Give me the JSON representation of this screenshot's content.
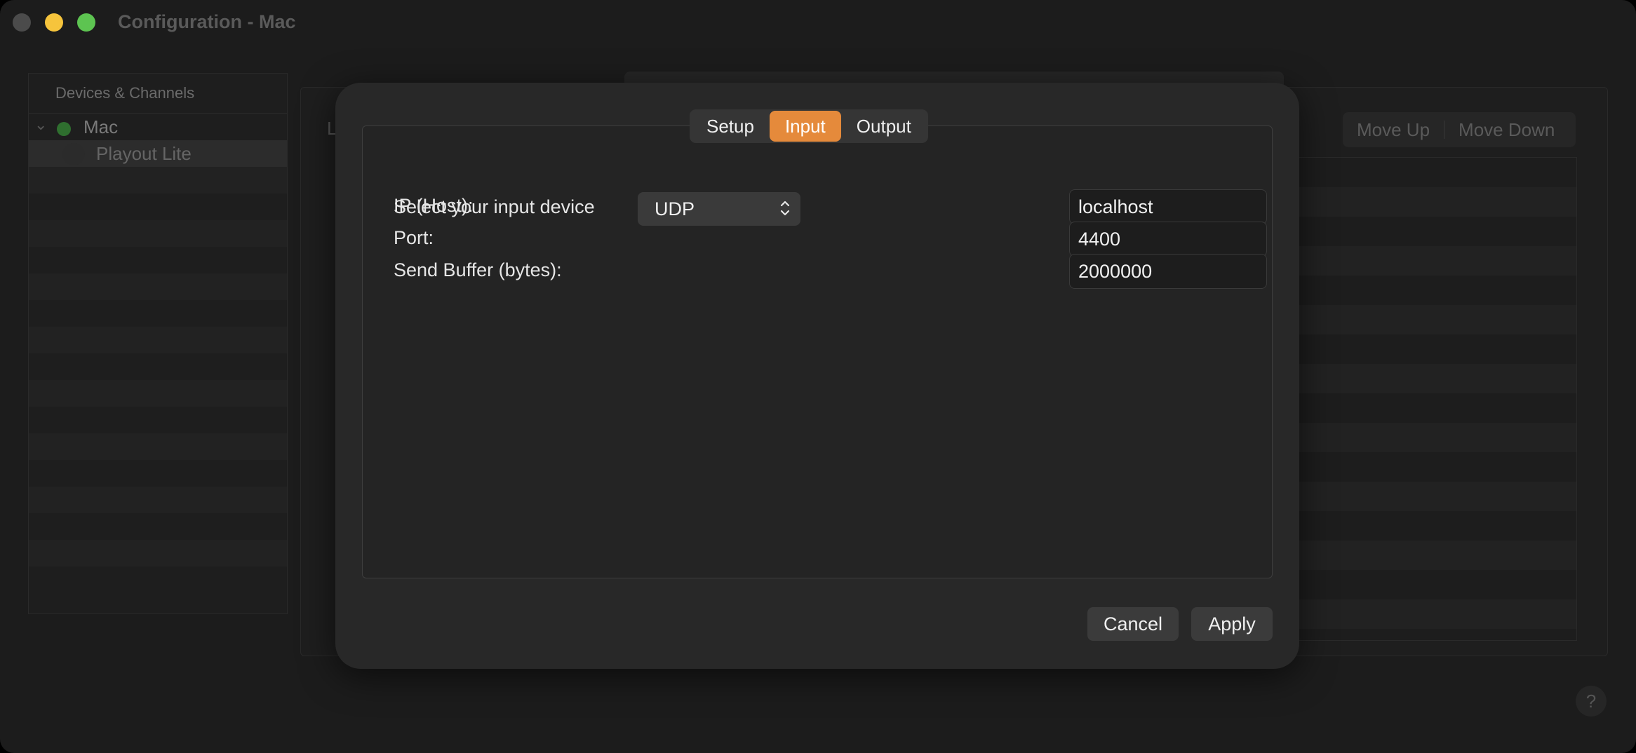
{
  "window": {
    "title": "Configuration - Mac"
  },
  "sidebar": {
    "header": "Devices & Channels",
    "tree": [
      {
        "label": "Mac",
        "status_color": "#2f6f2f",
        "expanded": true
      },
      {
        "label": "Playout Lite",
        "selected": true
      }
    ]
  },
  "background": {
    "partial_label": "L",
    "move_up": "Move Up",
    "move_down": "Move Down",
    "help": "?"
  },
  "dialog": {
    "tabs": [
      {
        "label": "Setup",
        "active": false
      },
      {
        "label": "Input",
        "active": true
      },
      {
        "label": "Output",
        "active": false
      }
    ],
    "input_device_label": "Select your input device",
    "input_device_value": "UDP",
    "fields": [
      {
        "label": "IP (Host):",
        "value": "localhost"
      },
      {
        "label": "Port:",
        "value": "4400"
      },
      {
        "label": "Send Buffer (bytes):",
        "value": "2000000"
      }
    ],
    "cancel_label": "Cancel",
    "apply_label": "Apply",
    "accent_color": "#e58a3b"
  }
}
